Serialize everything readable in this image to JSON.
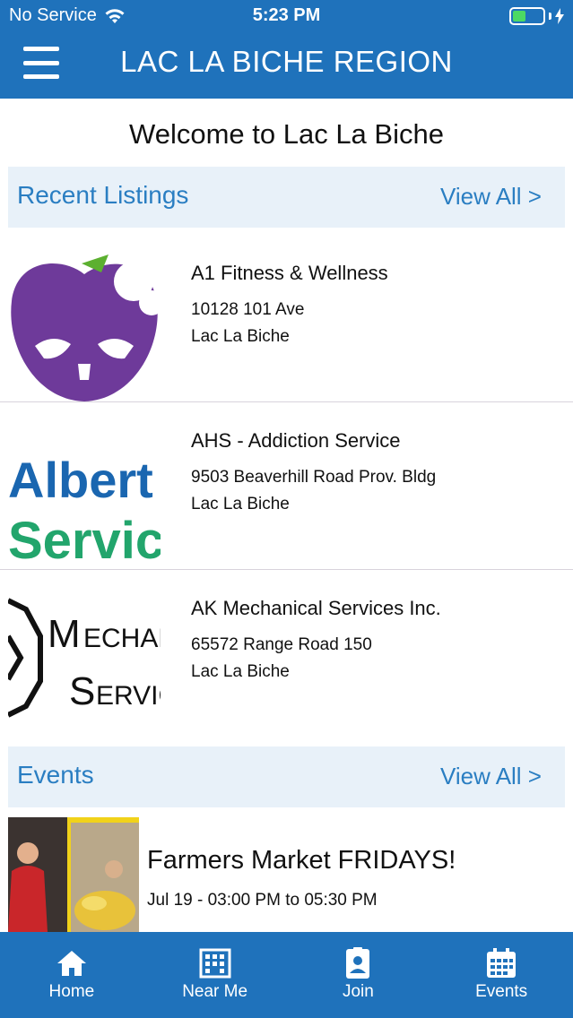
{
  "status": {
    "carrier": "No Service",
    "time": "5:23 PM",
    "battery_level": 0.45
  },
  "header": {
    "title": "LAC LA BICHE REGION",
    "menu_icon": "hamburger-menu-icon"
  },
  "welcome": "Welcome to Lac La Biche",
  "recent": {
    "label": "Recent Listings",
    "view_all": "View All >",
    "items": [
      {
        "name": "A1 Fitness & Wellness",
        "address": "10128 101 Ave",
        "city": "Lac La Biche",
        "logo_text": ""
      },
      {
        "name": "AHS - Addiction Service",
        "address": "9503 Beaverhill Road Prov. Bldg",
        "city": "Lac La Biche",
        "logo_text": "Alberta Services"
      },
      {
        "name": "AK Mechanical Services Inc.",
        "address": "65572 Range Road 150",
        "city": "Lac La Biche",
        "logo_text": "Mechanical Services"
      }
    ]
  },
  "events": {
    "label": "Events",
    "view_all": "View All >",
    "items": [
      {
        "title": "Farmers Market FRIDAYS!",
        "when": "Jul 19 - 03:00 PM to 05:30 PM"
      }
    ]
  },
  "tabs": [
    {
      "label": "Home",
      "icon": "home-icon"
    },
    {
      "label": "Near Me",
      "icon": "building-icon"
    },
    {
      "label": "Join",
      "icon": "contact-card-icon"
    },
    {
      "label": "Events",
      "icon": "calendar-icon"
    }
  ],
  "colors": {
    "brand": "#1f72bb",
    "section_bg": "#e8f1f9",
    "link": "#2a7ec2"
  }
}
